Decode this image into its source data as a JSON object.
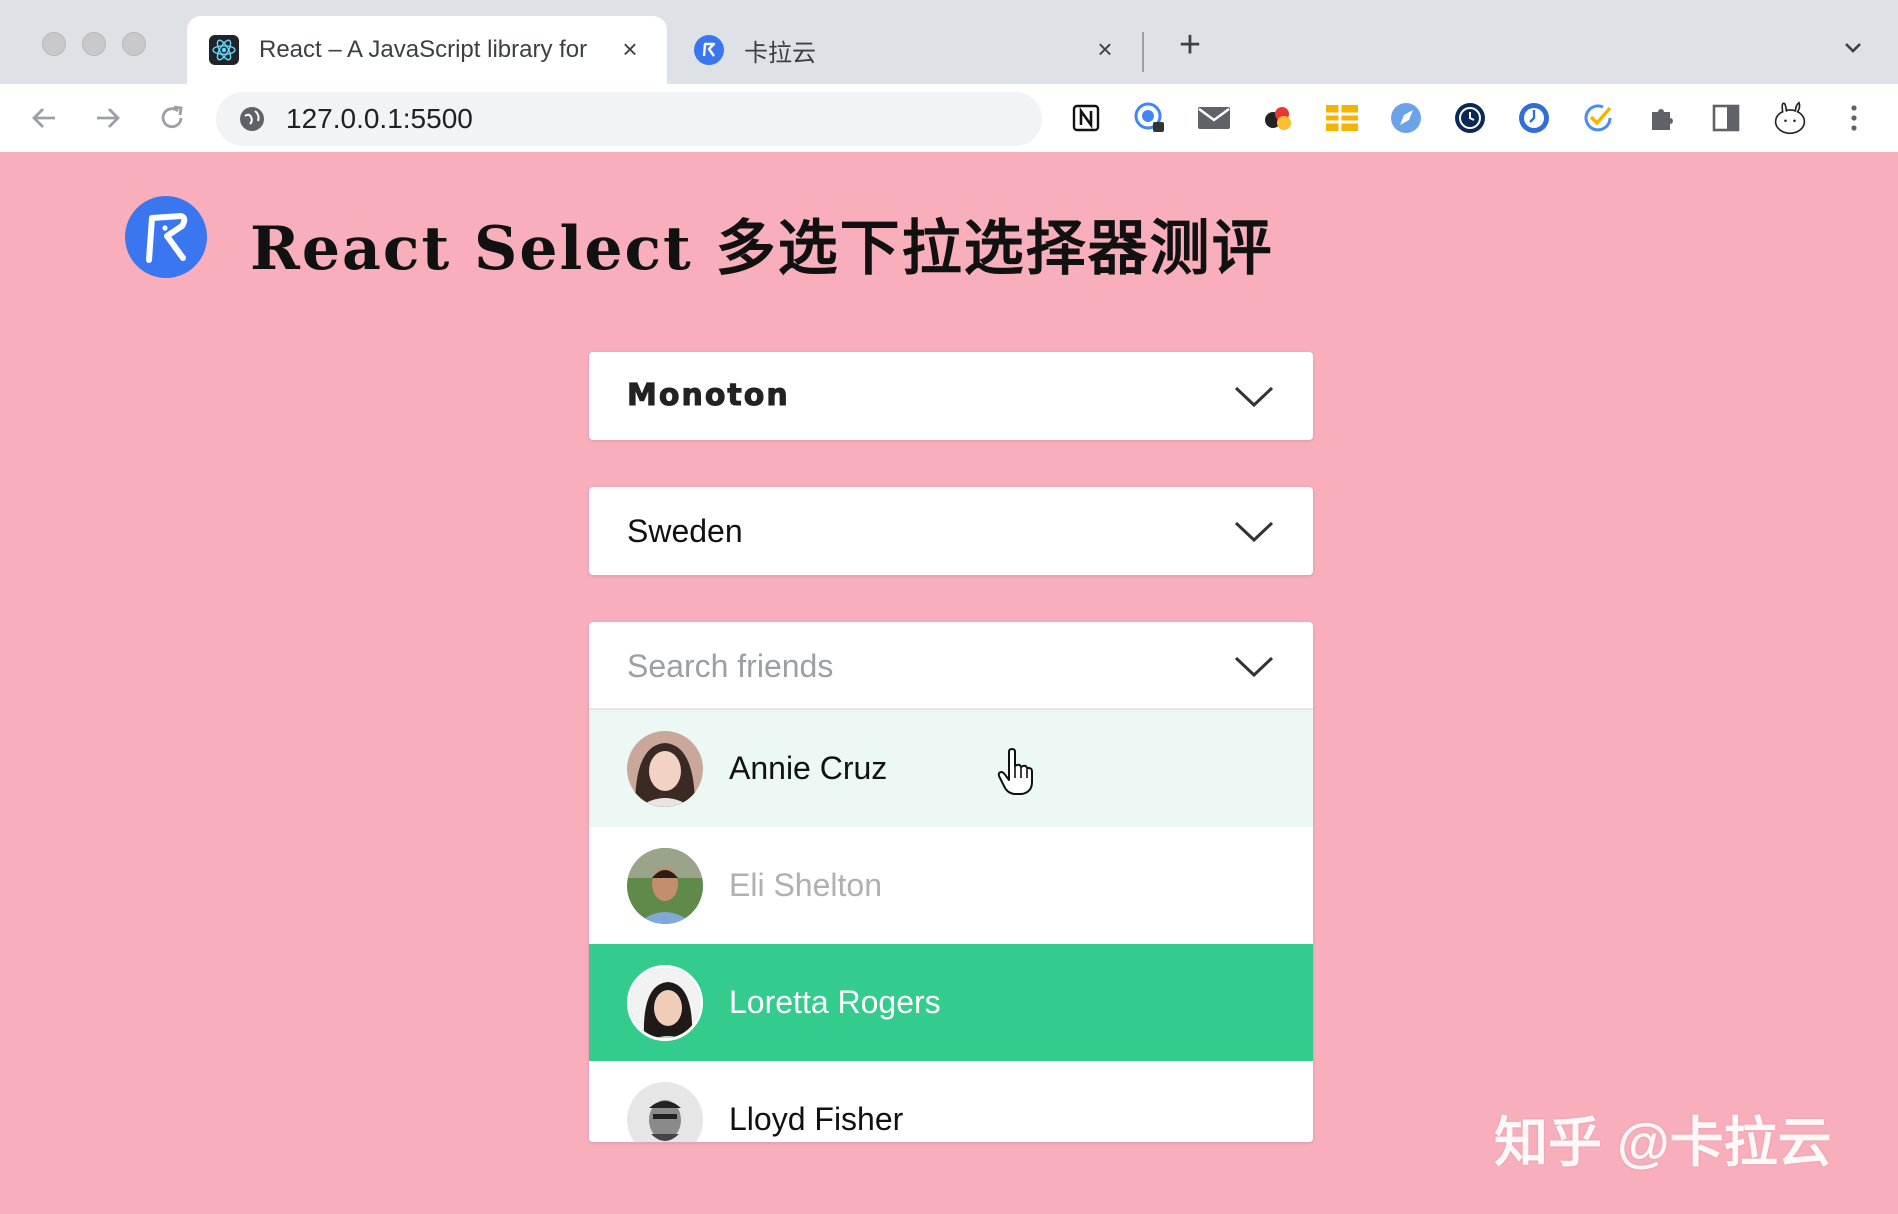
{
  "browser": {
    "tabs": [
      {
        "title": "React – A JavaScript library for",
        "active": true,
        "favicon": "react-icon"
      },
      {
        "title": "卡拉云",
        "active": false,
        "favicon": "kalayun-icon"
      }
    ],
    "address": "127.0.0.1:5500",
    "new_tab_label": "+",
    "close_label": "×"
  },
  "page": {
    "title": "React Select 多选下拉选择器测评",
    "accent_color": "#f8aebb",
    "selects": {
      "font": {
        "value": "Monoton"
      },
      "country": {
        "value": "Sweden"
      },
      "friends": {
        "placeholder": "Search friends",
        "options": [
          {
            "name": "Annie Cruz",
            "state": "hovered",
            "bg": "#ecf8f4",
            "color": "#111111"
          },
          {
            "name": "Eli Shelton",
            "state": "disabled",
            "bg": "#ffffff",
            "color": "#b0b0b0"
          },
          {
            "name": "Loretta Rogers",
            "state": "selected",
            "bg": "#33cc8d",
            "color": "#ffffff"
          },
          {
            "name": "Lloyd Fisher",
            "state": "normal",
            "bg": "#ffffff",
            "color": "#111111"
          }
        ]
      }
    }
  },
  "watermark": "知乎 @卡拉云"
}
